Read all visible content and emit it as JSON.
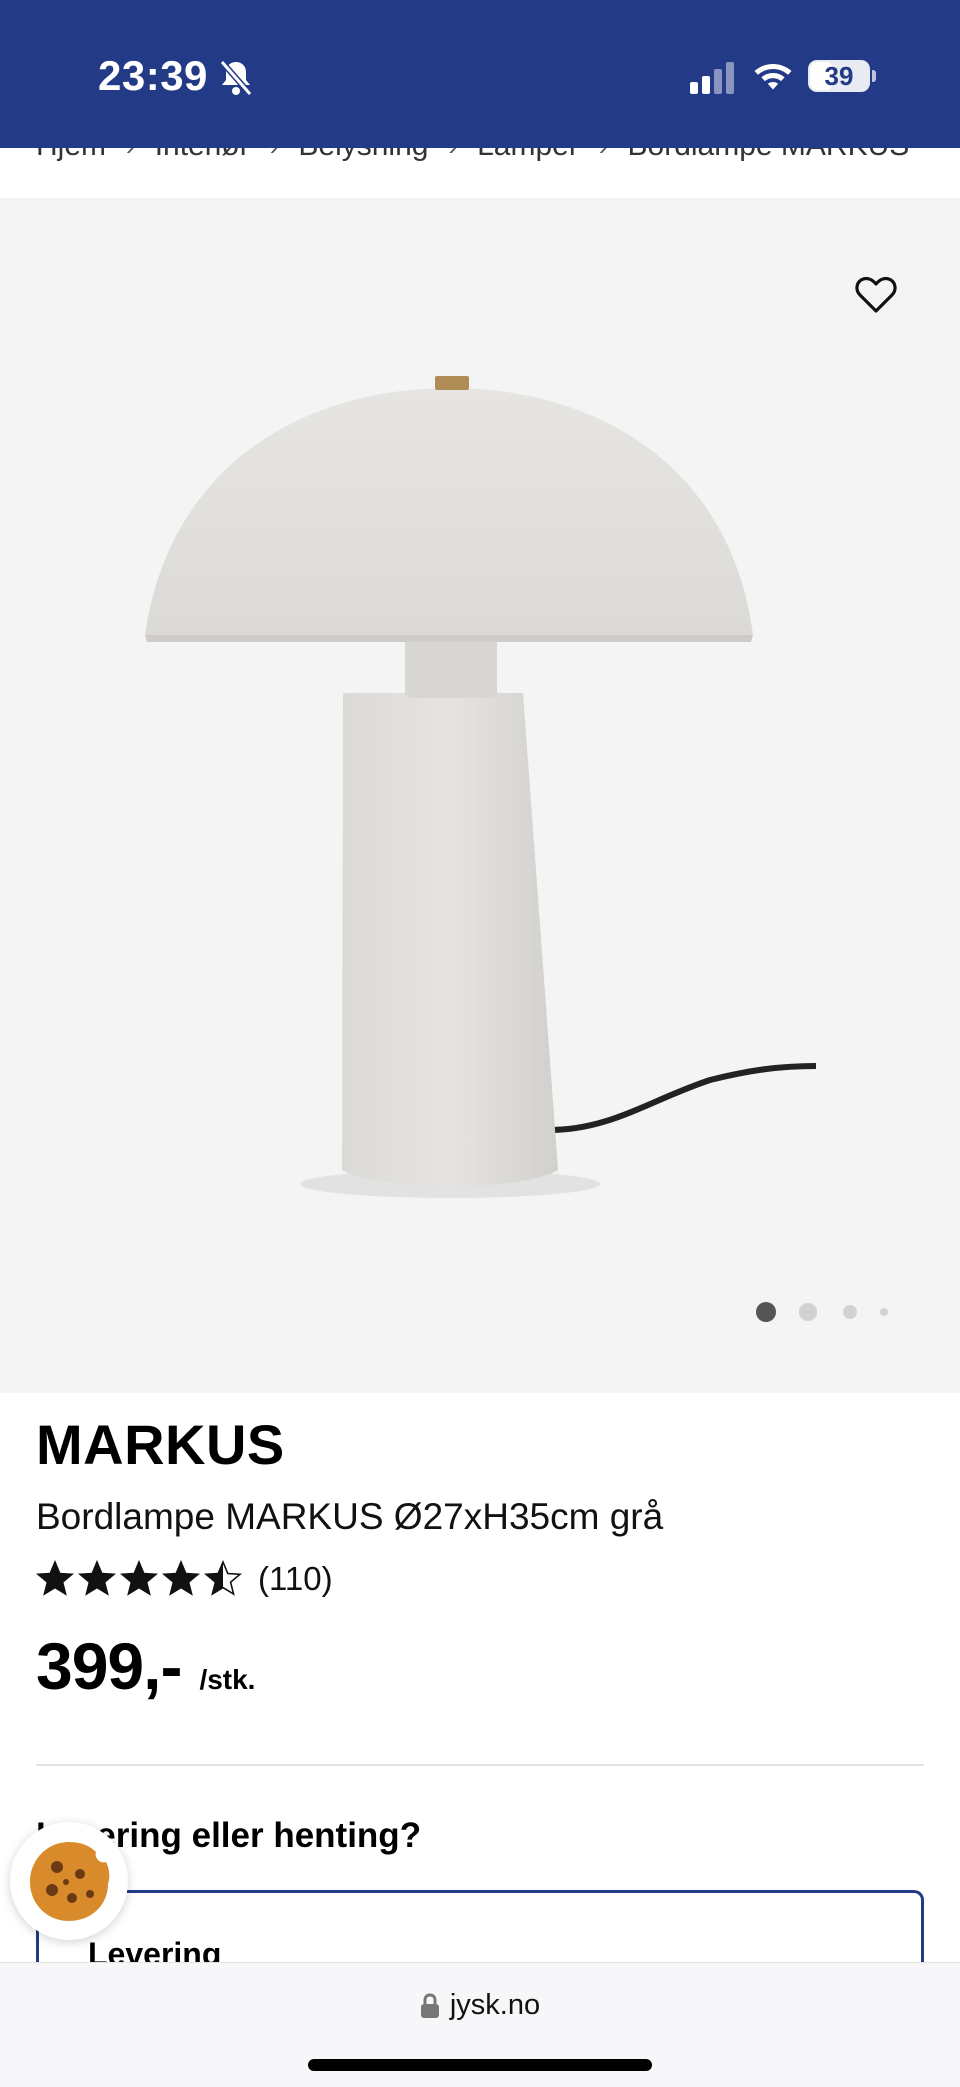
{
  "status_bar": {
    "time": "23:39",
    "battery": "39",
    "battery_level": 0.39
  },
  "breadcrumb": [
    "Hjem",
    "Interiør",
    "Belysning",
    "Lamper",
    "Bordlampe MARKUS"
  ],
  "gallery": {
    "image": "table-lamp-image",
    "active_slide": 1,
    "slide_count": 4
  },
  "product": {
    "brand": "MARKUS",
    "name": "Bordlampe MARKUS Ø27xH35cm grå",
    "rating_value": 4.5,
    "rating_count": "(110)",
    "price": "399,-",
    "price_unit": "/stk."
  },
  "delivery": {
    "question": "Levering eller henting?",
    "option_label": "Levering"
  },
  "browser": {
    "url": "jysk.no"
  },
  "colors": {
    "brand_blue": "#233a86",
    "image_bg": "#f4f4f4"
  }
}
